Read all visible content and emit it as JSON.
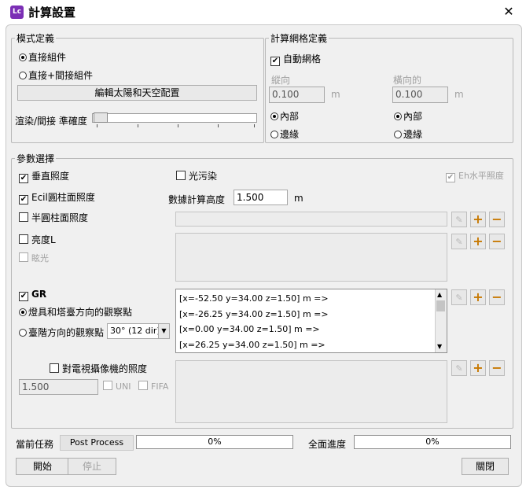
{
  "window": {
    "app_icon": "Lc",
    "title": "計算設置",
    "close_glyph": "✕"
  },
  "mode": {
    "legend": "模式定義",
    "radio_direct": "直接組件",
    "radio_direct_indirect": "直接+間接組件",
    "sun_sky_button": "編輯太陽和天空配置",
    "accuracy_label": "渲染/間接 準確度",
    "accuracy_level": 0.0
  },
  "grid": {
    "legend": "計算網格定義",
    "auto_grid": "自動網格",
    "vertical_label": "縱向",
    "horizontal_label": "橫向的",
    "vertical_value": "0.100",
    "horizontal_value": "0.100",
    "unit": "m",
    "inner": "內部",
    "edge": "邊緣"
  },
  "params": {
    "legend": "參數選擇",
    "vertical_illuminance": "垂直照度",
    "light_pollution": "光污染",
    "eh_horizontal": "Eh水平照度",
    "ecil": "Ecil圓柱面照度",
    "calc_height_label": "數據計算高度",
    "calc_height_value": "1.500",
    "calc_height_unit": "m",
    "semi_cylindrical": "半圓柱面照度",
    "luminance": "亮度L",
    "glare": "眩光",
    "gr": "GR",
    "gr_luminaire_dir": "燈具和塔臺方向的觀察點",
    "gr_step_dir": "臺階方向的觀察點",
    "gr_step_select": "30° (12 dir)",
    "observer_points": [
      "[x=-52.50 y=34.00 z=1.50] m =>",
      "[x=-26.25 y=34.00 z=1.50] m =>",
      "[x=0.00 y=34.00 z=1.50] m =>",
      "[x=26.25 y=34.00 z=1.50] m =>"
    ],
    "tv_camera": "對電視攝像機的照度",
    "tv_value": "1.500",
    "uni": "UNI",
    "fifa": "FIFA"
  },
  "status": {
    "current_task_label": "當前任務",
    "current_task_value": "Post Process",
    "task_progress": "0%",
    "overall_label": "全面進度",
    "overall_progress": "0%"
  },
  "buttons": {
    "start": "開始",
    "stop": "停止",
    "close": "關閉"
  },
  "icons": {
    "edit": "✎",
    "add": "+",
    "remove": "−"
  }
}
